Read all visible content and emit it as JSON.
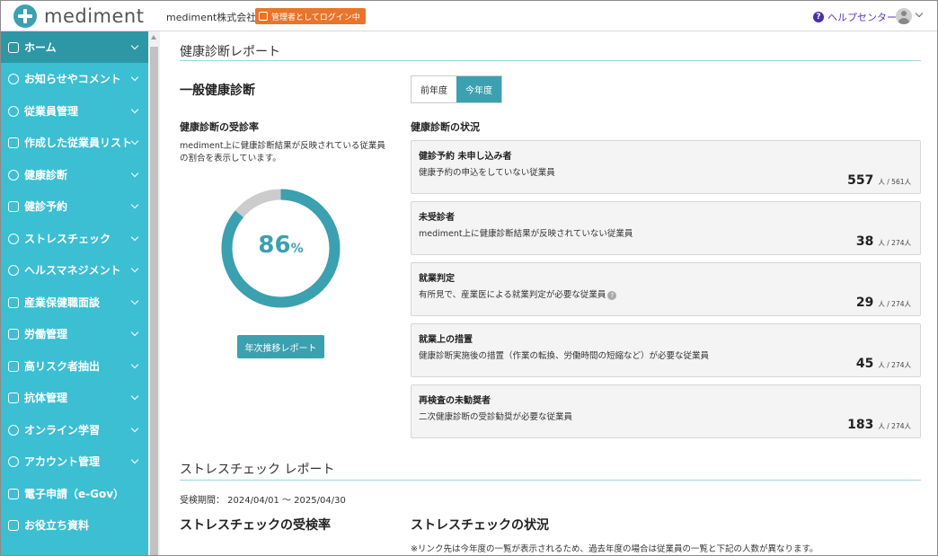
{
  "header": {
    "logo_text": "mediment",
    "company": "mediment株式会社",
    "admin_badge": "管理者としてログイン中",
    "help": "ヘルプセンター"
  },
  "sidebar": {
    "items": [
      {
        "label": "ホーム",
        "icon": "home-icon"
      },
      {
        "label": "お知らせやコメント",
        "icon": "bell-icon"
      },
      {
        "label": "従業員管理",
        "icon": "users-icon"
      },
      {
        "label": "作成した従業員リスト",
        "icon": "list-icon"
      },
      {
        "label": "健康診断",
        "icon": "stethoscope-icon"
      },
      {
        "label": "健診予約",
        "icon": "calendar-check-icon"
      },
      {
        "label": "ストレスチェック",
        "icon": "heart-icon"
      },
      {
        "label": "ヘルスマネジメント",
        "icon": "person-heart-icon"
      },
      {
        "label": "産業保健職面談",
        "icon": "building-icon"
      },
      {
        "label": "労働管理",
        "icon": "timer-icon"
      },
      {
        "label": "高リスク者抽出",
        "icon": "warning-icon"
      },
      {
        "label": "抗体管理",
        "icon": "syringe-icon"
      },
      {
        "label": "オンライン学習",
        "icon": "graduation-cap-icon"
      },
      {
        "label": "アカウント管理",
        "icon": "gear-icon"
      },
      {
        "label": "電子申請（e-Gov）",
        "icon": "monitor-check-icon"
      },
      {
        "label": "お役立ち資料",
        "icon": "document-icon"
      }
    ]
  },
  "health_report": {
    "title": "健康診断レポート",
    "heading": "一般健康診断",
    "tabs": [
      "前年度",
      "今年度"
    ],
    "active_tab": "今年度",
    "rate": {
      "title": "健康診断の受診率",
      "description": "mediment上に健康診断結果が反映されている従業員の割合を表示しています。",
      "value": "86",
      "unit": "%",
      "fraction": 0.86,
      "button": "年次推移レポート"
    },
    "status_title": "健康診断の状況",
    "cards": [
      {
        "title": "健診予約 未申し込み者",
        "desc": "健康予約の申込をしていない従業員",
        "count": "557",
        "unit": "人 / 561人"
      },
      {
        "title": "未受診者",
        "desc": "mediment上に健康診断結果が反映されていない従業員",
        "count": "38",
        "unit": "人 / 274人"
      },
      {
        "title": "就業判定",
        "desc": "有所見で、産業医による就業判定が必要な従業員",
        "count": "29",
        "unit": "人 / 274人"
      },
      {
        "title": "就業上の措置",
        "desc": "健康診断実施後の措置（作業の転換、労働時間の短縮など）が必要な従業員",
        "count": "45",
        "unit": "人 / 274人"
      },
      {
        "title": "再検査の未勧奨者",
        "desc": "二次健康診断の受診勧奨が必要な従業員",
        "count": "183",
        "unit": "人 / 274人"
      }
    ]
  },
  "stress_report": {
    "title": "ストレスチェック レポート",
    "period": "受検期間： 2024/04/01 ～ 2025/04/30",
    "rate_title": "ストレスチェックの受検率",
    "status_title": "ストレスチェックの状況",
    "note": "※リンク先は今年度の一覧が表示されるため、過去年度の場合は従業員の一覧と下記の人数が異なります。"
  },
  "colors": {
    "accent": "#3ba0b0",
    "sidebar": "#3cbfd2",
    "sidebar_active": "#2e97a6",
    "badge": "#e8752a",
    "donut_rest": "#cccccc"
  }
}
